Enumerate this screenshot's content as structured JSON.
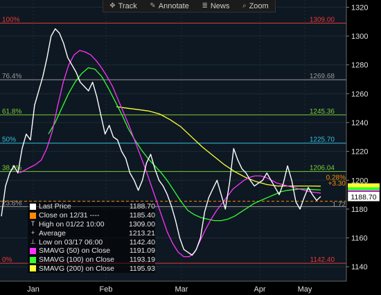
{
  "toolbar": {
    "track": {
      "label": "Track",
      "icon": "track-icon"
    },
    "annotate": {
      "label": "Annotate",
      "icon": "pencil-icon"
    },
    "news": {
      "label": "News",
      "icon": "news-icon"
    },
    "zoom": {
      "label": "Zoom",
      "icon": "magnifier-icon"
    }
  },
  "legend": [
    {
      "label": "Last Price",
      "value": "1188.70",
      "color": "#ffffff",
      "marker": "box"
    },
    {
      "label": "Close on 12/31 ----",
      "value": "1185.40",
      "color": "#ff8c00",
      "marker": "box"
    },
    {
      "label": "High on 01/22 10:00",
      "value": "1309.00",
      "color": "#dddddd",
      "marker": "T"
    },
    {
      "label": "Average",
      "value": "1213.21",
      "color": "#dddddd",
      "marker": "+"
    },
    {
      "label": "Low on 03/17 06:00",
      "value": "1142.40",
      "color": "#dddddd",
      "marker": "⊥"
    },
    {
      "label": "SMAVG (50) on Close",
      "value": "1191.09",
      "color": "#ff33ff",
      "marker": "box"
    },
    {
      "label": "SMAVG (100) on Close",
      "value": "1193.19",
      "color": "#33ff33",
      "marker": "box"
    },
    {
      "label": "SMAVG (200) on Close",
      "value": "1195.93",
      "color": "#ffff33",
      "marker": "box"
    }
  ],
  "chart_data": {
    "type": "line",
    "ylim": [
      1130,
      1325
    ],
    "yticks": [
      1140,
      1160,
      1180,
      1200,
      1220,
      1240,
      1260,
      1280,
      1300,
      1320
    ],
    "x_month_labels": [
      "Jan",
      "Feb",
      "Mar",
      "Apr",
      "May"
    ],
    "last_price_label": "1188.70",
    "right_tags": [
      "0.28%",
      "+3.30",
      "1.72"
    ],
    "fib_levels": [
      {
        "pct": "100%",
        "value": "1309.00",
        "y": 1309.0,
        "color": "#e83a3a"
      },
      {
        "pct": "76.4%",
        "value": "1269.68",
        "y": 1269.68,
        "color": "#9a9a9a"
      },
      {
        "pct": "61.8%",
        "value": "1245.36",
        "y": 1245.36,
        "color": "#7acc3a"
      },
      {
        "pct": "50%",
        "value": "1225.70",
        "y": 1225.7,
        "color": "#35c0e0"
      },
      {
        "pct": "38.2%",
        "value": "1206.04",
        "y": 1206.04,
        "color": "#7acc3a"
      },
      {
        "pct": "23.6%",
        "value": "",
        "y": 1181.72,
        "color": "#9a9a9a"
      },
      {
        "pct": "0%",
        "value": "1142.40",
        "y": 1142.4,
        "color": "#e83a3a"
      }
    ],
    "close_ref": 1185.4,
    "series": [
      {
        "name": "Last Price",
        "color": "#ffffff",
        "values": [
          1175,
          1196,
          1205,
          1210,
          1205,
          1222,
          1232,
          1228,
          1252,
          1262,
          1272,
          1285,
          1300,
          1305,
          1302,
          1295,
          1285,
          1280,
          1275,
          1268,
          1265,
          1262,
          1268,
          1258,
          1245,
          1232,
          1238,
          1230,
          1228,
          1220,
          1215,
          1205,
          1200,
          1193,
          1200,
          1212,
          1218,
          1208,
          1200,
          1196,
          1190,
          1182,
          1172,
          1160,
          1152,
          1150,
          1148,
          1152,
          1160,
          1178,
          1188,
          1194,
          1200,
          1190,
          1180,
          1198,
          1222,
          1214,
          1208,
          1205,
          1200,
          1196,
          1198,
          1200,
          1205,
          1200,
          1195,
          1190,
          1198,
          1210,
          1200,
          1185,
          1180,
          1188,
          1195,
          1190,
          1186,
          1188.7
        ]
      },
      {
        "name": "SMAVG (50) on Close",
        "color": "#ff33ff",
        "values": [
          1205,
          1207,
          1209,
          1211,
          1214,
          1222,
          1234,
          1252,
          1268,
          1280,
          1287,
          1290,
          1289,
          1287,
          1283,
          1278,
          1272,
          1265,
          1256,
          1247,
          1238,
          1228,
          1218,
          1208,
          1197,
          1186,
          1175,
          1164,
          1156,
          1150,
          1147,
          1147,
          1150,
          1158,
          1166,
          1173,
          1179,
          1184,
          1189,
          1194,
          1197,
          1200,
          1202,
          1203,
          1203,
          1202,
          1200,
          1198,
          1197,
          1196,
          1195,
          1194,
          1193,
          1192,
          1191.5,
          1191.09
        ]
      },
      {
        "name": "SMAVG (100) on Close",
        "color": "#33ff33",
        "values": [
          1232,
          1240,
          1250,
          1260,
          1268,
          1274,
          1278,
          1277,
          1272,
          1264,
          1255,
          1246,
          1236,
          1228,
          1221,
          1215,
          1210,
          1205,
          1199,
          1192,
          1185,
          1179,
          1176,
          1174,
          1173,
          1172,
          1172,
          1173,
          1175,
          1178,
          1181,
          1184,
          1186,
          1188,
          1190,
          1192,
          1193,
          1193.5,
          1194,
          1193.8,
          1193.5,
          1193.19
        ]
      },
      {
        "name": "SMAVG (200) on Close",
        "color": "#ffff33",
        "values": [
          1251,
          1250,
          1249,
          1248,
          1246,
          1242,
          1237,
          1230,
          1223,
          1217,
          1211,
          1206,
          1202,
          1199,
          1197,
          1196,
          1196,
          1196,
          1196,
          1195.9
        ]
      }
    ]
  }
}
